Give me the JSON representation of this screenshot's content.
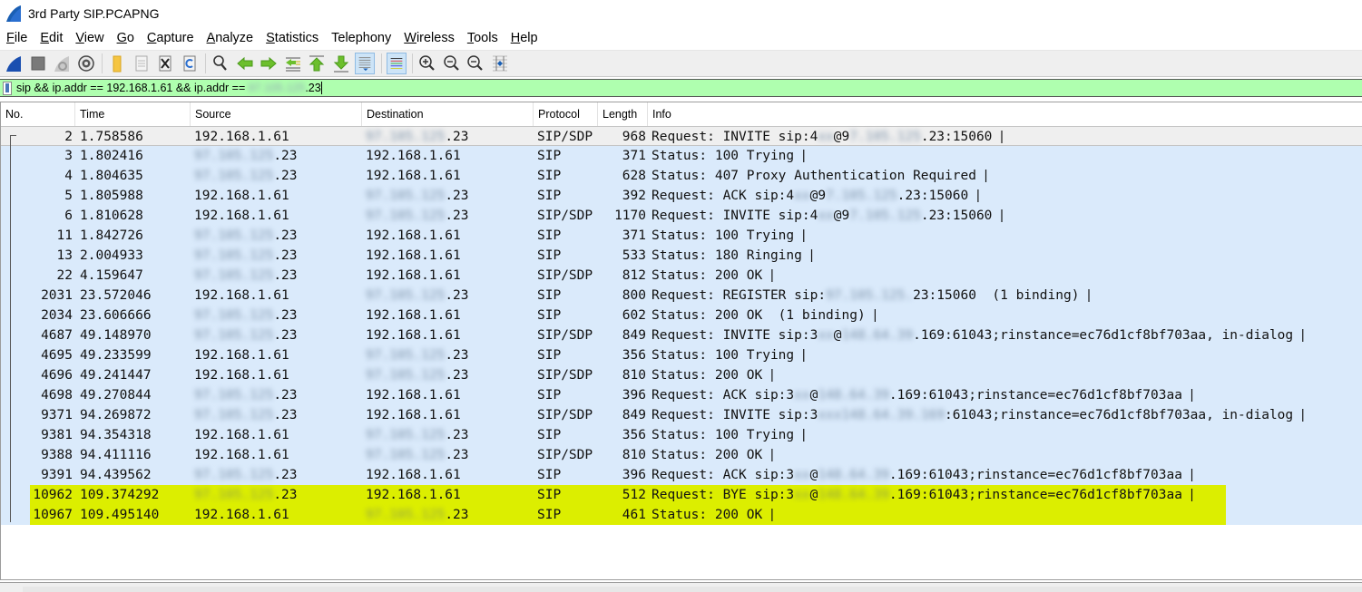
{
  "window": {
    "title": "3rd Party SIP.PCAPNG",
    "icon": "wireshark-fin-icon"
  },
  "menu": [
    {
      "label": "File",
      "accel": "F",
      "rest": "ile"
    },
    {
      "label": "Edit",
      "accel": "E",
      "rest": "dit"
    },
    {
      "label": "View",
      "accel": "V",
      "rest": "iew"
    },
    {
      "label": "Go",
      "accel": "G",
      "rest": "o"
    },
    {
      "label": "Capture",
      "accel": "C",
      "rest": "apture"
    },
    {
      "label": "Analyze",
      "accel": "A",
      "rest": "nalyze"
    },
    {
      "label": "Statistics",
      "accel": "S",
      "rest": "tatistics"
    },
    {
      "label": "Telephony",
      "accel": "",
      "rest": "Telephony"
    },
    {
      "label": "Wireless",
      "accel": "W",
      "rest": "ireless"
    },
    {
      "label": "Tools",
      "accel": "T",
      "rest": "ools"
    },
    {
      "label": "Help",
      "accel": "H",
      "rest": "elp"
    }
  ],
  "toolbar": [
    {
      "name": "start-capture-icon"
    },
    {
      "name": "stop-capture-icon"
    },
    {
      "name": "restart-capture-icon"
    },
    {
      "name": "capture-options-icon"
    },
    {
      "sep": true
    },
    {
      "name": "open-file-icon"
    },
    {
      "name": "save-file-icon"
    },
    {
      "name": "close-file-icon"
    },
    {
      "name": "reload-file-icon"
    },
    {
      "sep": true
    },
    {
      "name": "find-packet-icon"
    },
    {
      "name": "go-back-icon"
    },
    {
      "name": "go-forward-icon"
    },
    {
      "name": "go-to-packet-icon"
    },
    {
      "name": "go-first-packet-icon"
    },
    {
      "name": "go-last-packet-icon"
    },
    {
      "name": "auto-scroll-icon",
      "active": true
    },
    {
      "sep": true
    },
    {
      "name": "colorize-icon",
      "active": true
    },
    {
      "sep": true
    },
    {
      "name": "zoom-in-icon"
    },
    {
      "name": "zoom-out-icon"
    },
    {
      "name": "normal-size-icon"
    },
    {
      "name": "resize-columns-icon"
    }
  ],
  "filter": {
    "prefix": "sip && ip.addr == 192.168.1.61 && ip.addr == ",
    "redacted": "97.105.125",
    "suffix": ".23",
    "valid_color": "#afffaf"
  },
  "columns": [
    "No.",
    "Time",
    "Source",
    "Destination",
    "Protocol",
    "Length",
    "Info"
  ],
  "colors": {
    "row_bg": "#daeafb",
    "selected_bg": "#efefef",
    "highlight_bg": "#dcee00"
  },
  "packets": [
    {
      "no": "2",
      "time": "1.758586",
      "src": [
        "",
        "192.168.1.61"
      ],
      "dst": [
        "97.105.125",
        ".23"
      ],
      "proto": "SIP/SDP",
      "len": "968",
      "info": [
        [
          "",
          "Request: INVITE sip:4"
        ],
        [
          "xx",
          ""
        ],
        [
          "",
          "@9"
        ],
        [
          "7.105.125",
          ""
        ],
        [
          "",
          ".23:15060 "
        ]
      ],
      "state": "selected"
    },
    {
      "no": "3",
      "time": "1.802416",
      "src": [
        "97.105.125",
        ".23"
      ],
      "dst": [
        "",
        "192.168.1.61"
      ],
      "proto": "SIP",
      "len": "371",
      "info": [
        [
          "",
          "Status: 100 Trying "
        ]
      ]
    },
    {
      "no": "4",
      "time": "1.804635",
      "src": [
        "97.105.125",
        ".23"
      ],
      "dst": [
        "",
        "192.168.1.61"
      ],
      "proto": "SIP",
      "len": "628",
      "info": [
        [
          "",
          "Status: 407 Proxy Authentication Required "
        ]
      ]
    },
    {
      "no": "5",
      "time": "1.805988",
      "src": [
        "",
        "192.168.1.61"
      ],
      "dst": [
        "97.105.125",
        ".23"
      ],
      "proto": "SIP",
      "len": "392",
      "info": [
        [
          "",
          "Request: ACK sip:4"
        ],
        [
          "xx",
          ""
        ],
        [
          "",
          "@9"
        ],
        [
          "7.105.125",
          ""
        ],
        [
          "",
          ".23:15060 "
        ]
      ]
    },
    {
      "no": "6",
      "time": "1.810628",
      "src": [
        "",
        "192.168.1.61"
      ],
      "dst": [
        "97.105.125",
        ".23"
      ],
      "proto": "SIP/SDP",
      "len": "1170",
      "info": [
        [
          "",
          "Request: INVITE sip:4"
        ],
        [
          "xx",
          ""
        ],
        [
          "",
          "@9"
        ],
        [
          "7.105.125",
          ""
        ],
        [
          "",
          ".23:15060 "
        ]
      ]
    },
    {
      "no": "11",
      "time": "1.842726",
      "src": [
        "97.105.125",
        ".23"
      ],
      "dst": [
        "",
        "192.168.1.61"
      ],
      "proto": "SIP",
      "len": "371",
      "info": [
        [
          "",
          "Status: 100 Trying "
        ]
      ]
    },
    {
      "no": "13",
      "time": "2.004933",
      "src": [
        "97.105.125",
        ".23"
      ],
      "dst": [
        "",
        "192.168.1.61"
      ],
      "proto": "SIP",
      "len": "533",
      "info": [
        [
          "",
          "Status: 180 Ringing "
        ]
      ]
    },
    {
      "no": "22",
      "time": "4.159647",
      "src": [
        "97.105.125",
        ".23"
      ],
      "dst": [
        "",
        "192.168.1.61"
      ],
      "proto": "SIP/SDP",
      "len": "812",
      "info": [
        [
          "",
          "Status: 200 OK "
        ]
      ]
    },
    {
      "no": "2031",
      "time": "23.572046",
      "src": [
        "",
        "192.168.1.61"
      ],
      "dst": [
        "97.105.125",
        ".23"
      ],
      "proto": "SIP",
      "len": "800",
      "info": [
        [
          "",
          "Request: REGISTER sip:"
        ],
        [
          "97.105.125.",
          ""
        ],
        [
          "",
          "23:15060  (1 binding) "
        ]
      ]
    },
    {
      "no": "2034",
      "time": "23.606666",
      "src": [
        "97.105.125",
        ".23"
      ],
      "dst": [
        "",
        "192.168.1.61"
      ],
      "proto": "SIP",
      "len": "602",
      "info": [
        [
          "",
          "Status: 200 OK  (1 binding) "
        ]
      ]
    },
    {
      "no": "4687",
      "time": "49.148970",
      "src": [
        "97.105.125",
        ".23"
      ],
      "dst": [
        "",
        "192.168.1.61"
      ],
      "proto": "SIP/SDP",
      "len": "849",
      "info": [
        [
          "",
          "Request: INVITE sip:3"
        ],
        [
          "xx",
          ""
        ],
        [
          "",
          "@"
        ],
        [
          "148.64.39",
          ""
        ],
        [
          "",
          ".169:61043;rinstance=ec76d1cf8bf703aa, in-dialog "
        ]
      ]
    },
    {
      "no": "4695",
      "time": "49.233599",
      "src": [
        "",
        "192.168.1.61"
      ],
      "dst": [
        "97.105.125",
        ".23"
      ],
      "proto": "SIP",
      "len": "356",
      "info": [
        [
          "",
          "Status: 100 Trying "
        ]
      ]
    },
    {
      "no": "4696",
      "time": "49.241447",
      "src": [
        "",
        "192.168.1.61"
      ],
      "dst": [
        "97.105.125",
        ".23"
      ],
      "proto": "SIP/SDP",
      "len": "810",
      "info": [
        [
          "",
          "Status: 200 OK "
        ]
      ]
    },
    {
      "no": "4698",
      "time": "49.270844",
      "src": [
        "97.105.125",
        ".23"
      ],
      "dst": [
        "",
        "192.168.1.61"
      ],
      "proto": "SIP",
      "len": "396",
      "info": [
        [
          "",
          "Request: ACK sip:3"
        ],
        [
          "xx",
          ""
        ],
        [
          "",
          "@"
        ],
        [
          "148.64.39",
          ""
        ],
        [
          "",
          ".169:61043;rinstance=ec76d1cf8bf703aa "
        ]
      ]
    },
    {
      "no": "9371",
      "time": "94.269872",
      "src": [
        "97.105.125",
        ".23"
      ],
      "dst": [
        "",
        "192.168.1.61"
      ],
      "proto": "SIP/SDP",
      "len": "849",
      "info": [
        [
          "",
          "Request: INVITE sip:3"
        ],
        [
          "xxx",
          ""
        ],
        [
          "148.64.39.169",
          ""
        ],
        [
          "",
          ":61043;rinstance=ec76d1cf8bf703aa, in-dialog "
        ]
      ]
    },
    {
      "no": "9381",
      "time": "94.354318",
      "src": [
        "",
        "192.168.1.61"
      ],
      "dst": [
        "97.105.125",
        ".23"
      ],
      "proto": "SIP",
      "len": "356",
      "info": [
        [
          "",
          "Status: 100 Trying "
        ]
      ]
    },
    {
      "no": "9388",
      "time": "94.411116",
      "src": [
        "",
        "192.168.1.61"
      ],
      "dst": [
        "97.105.125",
        ".23"
      ],
      "proto": "SIP/SDP",
      "len": "810",
      "info": [
        [
          "",
          "Status: 200 OK "
        ]
      ]
    },
    {
      "no": "9391",
      "time": "94.439562",
      "src": [
        "97.105.125",
        ".23"
      ],
      "dst": [
        "",
        "192.168.1.61"
      ],
      "proto": "SIP",
      "len": "396",
      "info": [
        [
          "",
          "Request: ACK sip:3"
        ],
        [
          "xx",
          ""
        ],
        [
          "",
          "@"
        ],
        [
          "148.64.39",
          ""
        ],
        [
          "",
          ".169:61043;rinstance=ec76d1cf8bf703aa "
        ]
      ]
    },
    {
      "no": "10962",
      "time": "109.374292",
      "src": [
        "97.105.125",
        ".23"
      ],
      "dst": [
        "",
        "192.168.1.61"
      ],
      "proto": "SIP",
      "len": "512",
      "info": [
        [
          "",
          "Request: BYE sip:3"
        ],
        [
          "xx",
          ""
        ],
        [
          "",
          "@"
        ],
        [
          "148.64.39",
          ""
        ],
        [
          "",
          ".169:61043;rinstance=ec76d1cf8bf703aa "
        ]
      ],
      "state": "highlight"
    },
    {
      "no": "10967",
      "time": "109.495140",
      "src": [
        "",
        "192.168.1.61"
      ],
      "dst": [
        "97.105.125",
        ".23"
      ],
      "proto": "SIP",
      "len": "461",
      "info": [
        [
          "",
          "Status: 200 OK "
        ]
      ],
      "state": "highlight"
    }
  ]
}
